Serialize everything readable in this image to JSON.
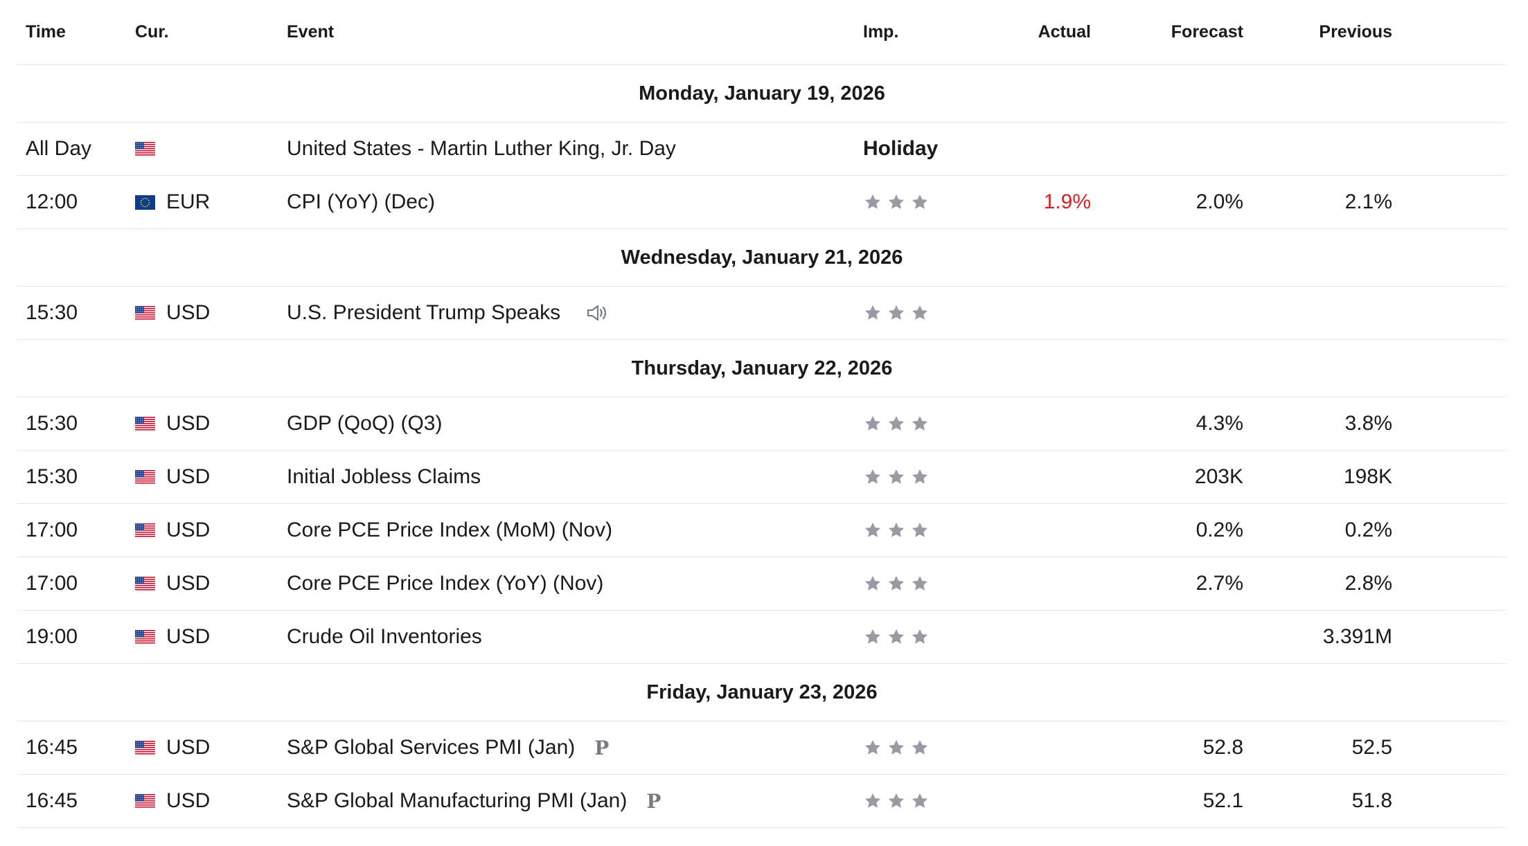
{
  "headers": {
    "time": "Time",
    "currency": "Cur.",
    "event": "Event",
    "importance": "Imp.",
    "actual": "Actual",
    "forecast": "Forecast",
    "previous": "Previous"
  },
  "colors": {
    "star_inactive": "#999aa3",
    "actual_negative": "#d42121",
    "divider": "#e6e6e6",
    "icon_gray": "#757a86"
  },
  "days": [
    {
      "date": "Monday, January 19, 2026",
      "events": [
        {
          "time": "All Day",
          "flag": "us-flag-icon",
          "currency": "",
          "event": "United States - Martin Luther King, Jr. Day",
          "importance_label": "Holiday",
          "actual": "",
          "forecast": "",
          "previous": ""
        },
        {
          "time": "12:00",
          "flag": "eu-flag-icon",
          "currency": "EUR",
          "event": "CPI (YoY) (Dec)",
          "importance": 3,
          "actual": "1.9%",
          "forecast": "2.0%",
          "previous": "2.1%"
        }
      ]
    },
    {
      "date": "Wednesday, January 21, 2026",
      "events": [
        {
          "time": "15:30",
          "flag": "us-flag-icon",
          "currency": "USD",
          "event": "U.S. President Trump Speaks",
          "icon": "speaker-icon",
          "importance": 3,
          "actual": "",
          "forecast": "",
          "previous": ""
        }
      ]
    },
    {
      "date": "Thursday, January 22, 2026",
      "events": [
        {
          "time": "15:30",
          "flag": "us-flag-icon",
          "currency": "USD",
          "event": "GDP (QoQ) (Q3)",
          "importance": 3,
          "actual": "",
          "forecast": "4.3%",
          "previous": "3.8%"
        },
        {
          "time": "15:30",
          "flag": "us-flag-icon",
          "currency": "USD",
          "event": "Initial Jobless Claims",
          "importance": 3,
          "actual": "",
          "forecast": "203K",
          "previous": "198K"
        },
        {
          "time": "17:00",
          "flag": "us-flag-icon",
          "currency": "USD",
          "event": "Core PCE Price Index (MoM) (Nov)",
          "importance": 3,
          "actual": "",
          "forecast": "0.2%",
          "previous": "0.2%"
        },
        {
          "time": "17:00",
          "flag": "us-flag-icon",
          "currency": "USD",
          "event": "Core PCE Price Index (YoY) (Nov)",
          "importance": 3,
          "actual": "",
          "forecast": "2.7%",
          "previous": "2.8%"
        },
        {
          "time": "19:00",
          "flag": "us-flag-icon",
          "currency": "USD",
          "event": "Crude Oil Inventories",
          "importance": 3,
          "actual": "",
          "forecast": "",
          "previous": "3.391M"
        }
      ]
    },
    {
      "date": "Friday, January 23, 2026",
      "events": [
        {
          "time": "16:45",
          "flag": "us-flag-icon",
          "currency": "USD",
          "event": "S&P Global Services PMI  (Jan)",
          "icon": "preliminary-icon",
          "icon_text": "P",
          "importance": 3,
          "actual": "",
          "forecast": "52.8",
          "previous": "52.5"
        },
        {
          "time": "16:45",
          "flag": "us-flag-icon",
          "currency": "USD",
          "event": "S&P Global Manufacturing PMI  (Jan)",
          "icon": "preliminary-icon",
          "icon_text": "P",
          "importance": 3,
          "actual": "",
          "forecast": "52.1",
          "previous": "51.8"
        }
      ]
    }
  ]
}
